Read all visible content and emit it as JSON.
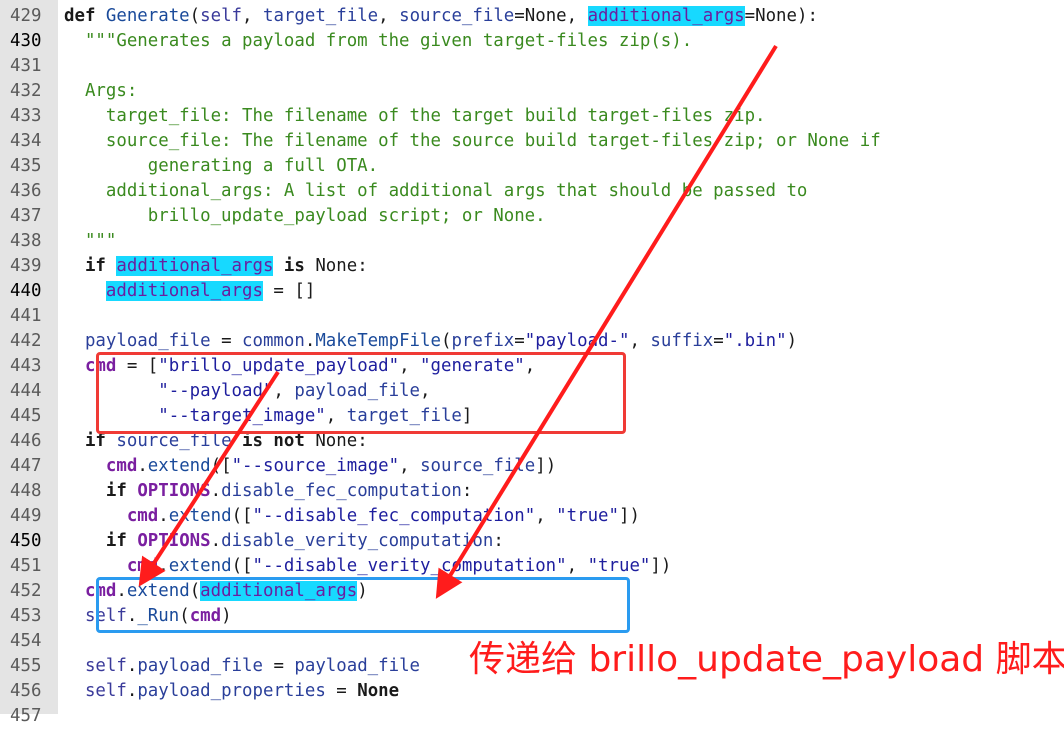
{
  "editor": {
    "lines": [
      {
        "no": "429",
        "indent": "",
        "tokens": [
          [
            "k",
            "def "
          ],
          [
            "fn",
            "Generate"
          ],
          [
            "pl",
            "("
          ],
          [
            "self",
            "self"
          ],
          [
            "pl",
            ", "
          ],
          [
            "nm",
            "target_file"
          ],
          [
            "pl",
            ", "
          ],
          [
            "nm",
            "source_file"
          ],
          [
            "pl",
            "=None, "
          ],
          [
            "hl",
            "additional_args"
          ],
          [
            "pl",
            "=None):"
          ]
        ]
      },
      {
        "no": "430",
        "current": true,
        "indent": "  ",
        "tokens": [
          [
            "doc",
            "\"\"\"Generates a payload from the given target-files zip(s)."
          ]
        ]
      },
      {
        "no": "431",
        "indent": "",
        "tokens": []
      },
      {
        "no": "432",
        "indent": "  ",
        "tokens": [
          [
            "doc",
            "Args:"
          ]
        ]
      },
      {
        "no": "433",
        "indent": "    ",
        "tokens": [
          [
            "doc",
            "target_file: The filename of the target build target-files zip."
          ]
        ]
      },
      {
        "no": "434",
        "indent": "    ",
        "tokens": [
          [
            "doc",
            "source_file: The filename of the source build target-files zip; or None if"
          ]
        ]
      },
      {
        "no": "435",
        "indent": "        ",
        "tokens": [
          [
            "doc",
            "generating a full OTA."
          ]
        ]
      },
      {
        "no": "436",
        "indent": "    ",
        "tokens": [
          [
            "doc",
            "additional_args: A list of additional args that should be passed to"
          ]
        ]
      },
      {
        "no": "437",
        "indent": "        ",
        "tokens": [
          [
            "doc",
            "brillo_update_payload script; or None."
          ]
        ]
      },
      {
        "no": "438",
        "indent": "  ",
        "tokens": [
          [
            "doc",
            "\"\"\""
          ]
        ]
      },
      {
        "no": "439",
        "indent": "  ",
        "tokens": [
          [
            "k",
            "if "
          ],
          [
            "hl",
            "additional_args"
          ],
          [
            "k",
            " is "
          ],
          [
            "pl",
            "None:"
          ]
        ]
      },
      {
        "no": "440",
        "current": true,
        "indent": "    ",
        "tokens": [
          [
            "hl",
            "additional_args"
          ],
          [
            "pl",
            " = []"
          ]
        ]
      },
      {
        "no": "441",
        "indent": "",
        "tokens": []
      },
      {
        "no": "442",
        "indent": "  ",
        "tokens": [
          [
            "nm",
            "payload_file"
          ],
          [
            "pl",
            " = "
          ],
          [
            "nm",
            "common"
          ],
          [
            "pl",
            "."
          ],
          [
            "fn",
            "MakeTempFile"
          ],
          [
            "pl",
            "("
          ],
          [
            "nm",
            "prefix"
          ],
          [
            "pl",
            "="
          ],
          [
            "st",
            "\"payload-\""
          ],
          [
            "pl",
            ", "
          ],
          [
            "nm",
            "suffix"
          ],
          [
            "pl",
            "="
          ],
          [
            "st",
            "\".bin\""
          ],
          [
            "pl",
            ")"
          ]
        ]
      },
      {
        "no": "443",
        "indent": "  ",
        "tokens": [
          [
            "kw",
            "cmd"
          ],
          [
            "pl",
            " = ["
          ],
          [
            "st",
            "\"brillo_update_payload\""
          ],
          [
            "pl",
            ", "
          ],
          [
            "st",
            "\"generate\""
          ],
          [
            "pl",
            ","
          ]
        ]
      },
      {
        "no": "444",
        "indent": "         ",
        "tokens": [
          [
            "st",
            "\"--payload\""
          ],
          [
            "pl",
            ", "
          ],
          [
            "nm",
            "payload_file"
          ],
          [
            "pl",
            ","
          ]
        ]
      },
      {
        "no": "445",
        "indent": "         ",
        "tokens": [
          [
            "st",
            "\"--target_image\""
          ],
          [
            "pl",
            ", "
          ],
          [
            "nm",
            "target_file"
          ],
          [
            "pl",
            "]"
          ]
        ]
      },
      {
        "no": "446",
        "indent": "  ",
        "tokens": [
          [
            "k",
            "if "
          ],
          [
            "nm",
            "source_file"
          ],
          [
            "k",
            " is not "
          ],
          [
            "pl",
            "None:"
          ]
        ]
      },
      {
        "no": "447",
        "indent": "    ",
        "tokens": [
          [
            "kw",
            "cmd"
          ],
          [
            "pl",
            "."
          ],
          [
            "fn",
            "extend"
          ],
          [
            "pl",
            "(["
          ],
          [
            "st",
            "\"--source_image\""
          ],
          [
            "pl",
            ", "
          ],
          [
            "nm",
            "source_file"
          ],
          [
            "pl",
            "])"
          ]
        ]
      },
      {
        "no": "448",
        "indent": "    ",
        "tokens": [
          [
            "k",
            "if "
          ],
          [
            "kw",
            "OPTIONS"
          ],
          [
            "pl",
            "."
          ],
          [
            "nm",
            "disable_fec_computation"
          ],
          [
            "pl",
            ":"
          ]
        ]
      },
      {
        "no": "449",
        "indent": "      ",
        "tokens": [
          [
            "kw",
            "cmd"
          ],
          [
            "pl",
            "."
          ],
          [
            "fn",
            "extend"
          ],
          [
            "pl",
            "(["
          ],
          [
            "st",
            "\"--disable_fec_computation\""
          ],
          [
            "pl",
            ", "
          ],
          [
            "st",
            "\"true\""
          ],
          [
            "pl",
            "])"
          ]
        ]
      },
      {
        "no": "450",
        "current": true,
        "indent": "    ",
        "tokens": [
          [
            "k",
            "if "
          ],
          [
            "kw",
            "OPTIONS"
          ],
          [
            "pl",
            "."
          ],
          [
            "nm",
            "disable_verity_computation"
          ],
          [
            "pl",
            ":"
          ]
        ]
      },
      {
        "no": "451",
        "indent": "      ",
        "tokens": [
          [
            "kw",
            "cmd"
          ],
          [
            "pl",
            "."
          ],
          [
            "fn",
            "extend"
          ],
          [
            "pl",
            "(["
          ],
          [
            "st",
            "\"--disable_verity_computation\""
          ],
          [
            "pl",
            ", "
          ],
          [
            "st",
            "\"true\""
          ],
          [
            "pl",
            "])"
          ]
        ]
      },
      {
        "no": "452",
        "indent": "  ",
        "tokens": [
          [
            "kw",
            "cmd"
          ],
          [
            "pl",
            "."
          ],
          [
            "fn",
            "extend"
          ],
          [
            "pl",
            "("
          ],
          [
            "hl",
            "additional_args"
          ],
          [
            "pl",
            ")"
          ]
        ]
      },
      {
        "no": "453",
        "indent": "  ",
        "tokens": [
          [
            "self",
            "self"
          ],
          [
            "pl",
            "."
          ],
          [
            "fn",
            "_Run"
          ],
          [
            "pl",
            "("
          ],
          [
            "kw",
            "cmd"
          ],
          [
            "pl",
            ")"
          ]
        ]
      },
      {
        "no": "454",
        "indent": "",
        "tokens": []
      },
      {
        "no": "455",
        "indent": "  ",
        "tokens": [
          [
            "self",
            "self"
          ],
          [
            "pl",
            "."
          ],
          [
            "nm",
            "payload_file"
          ],
          [
            "pl",
            " = "
          ],
          [
            "nm",
            "payload_file"
          ]
        ]
      },
      {
        "no": "456",
        "indent": "  ",
        "tokens": [
          [
            "self",
            "self"
          ],
          [
            "pl",
            "."
          ],
          [
            "nm",
            "payload_properties"
          ],
          [
            "pl",
            " = "
          ],
          [
            "k",
            "None"
          ]
        ]
      },
      {
        "no": "457",
        "indent": "",
        "tokens": []
      }
    ]
  },
  "annotation": {
    "caption": "传递给 brillo_update_payload 脚本"
  },
  "colors": {
    "highlight": "#17d9ff",
    "red_box": "#f03a35",
    "blue_box": "#2a9bf0",
    "arrow": "#ff1c1c",
    "gutter": "#e4e4e4"
  }
}
